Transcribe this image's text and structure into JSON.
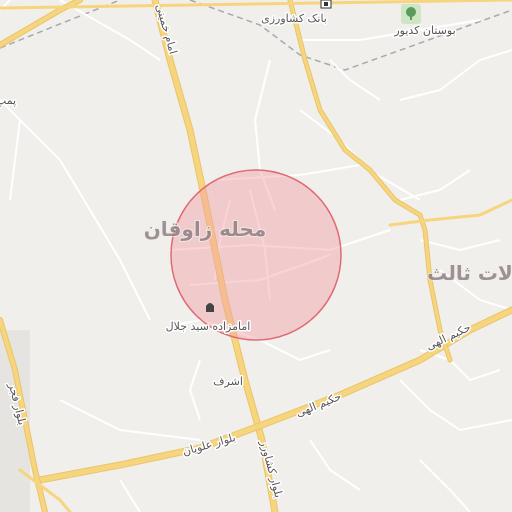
{
  "map": {
    "neighborhood_label": "محله زاوقان",
    "district_label": "لات ثالث",
    "poi_shrine": "امامزاده سید جلال",
    "poi_bank": "بانک کشاورزی",
    "poi_park": "بوستان کدیور",
    "street_ashraf": "اشرف",
    "street_hakim_elahi_1": "حکیم الهی",
    "street_hakim_elahi_2": "حکیم الهی",
    "street_keshavarz": "بلوار کشاورز",
    "street_alavian": "بلوار علویان",
    "street_fajr": "بلوار فجر",
    "street_imam_khomeini": "امام خمینی",
    "edge_label_left": "پمپ",
    "marker_circle": {
      "fill": "#f2a0a6",
      "stroke": "#e06a74"
    },
    "colors": {
      "background": "#f1efeb",
      "major_road": "#f7d57e",
      "minor_road": "#ffffff",
      "railway": "#a8a8b0"
    }
  }
}
